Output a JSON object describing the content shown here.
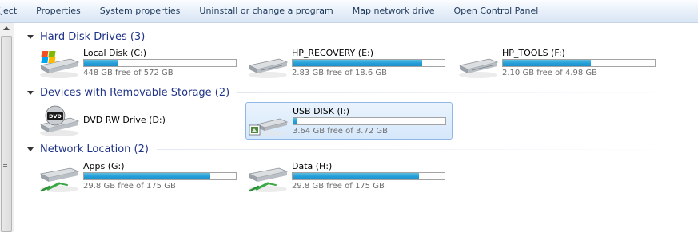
{
  "toolbar": {
    "items": [
      "Eject",
      "Properties",
      "System properties",
      "Uninstall or change a program",
      "Map network drive",
      "Open Control Panel"
    ]
  },
  "groups": [
    {
      "title": "Hard Disk Drives (3)",
      "drives": [
        {
          "name": "Local Disk (C:)",
          "free": "448 GB free of 572 GB",
          "used_fraction": 0.22,
          "icon": "windows-hard-drive-icon"
        },
        {
          "name": "HP_RECOVERY (E:)",
          "free": "2.83 GB free of 18.6 GB",
          "used_fraction": 0.85,
          "icon": "hard-drive-icon"
        },
        {
          "name": "HP_TOOLS (F:)",
          "free": "2.10 GB free of 4.98 GB",
          "used_fraction": 0.58,
          "icon": "hard-drive-icon"
        }
      ]
    },
    {
      "title": "Devices with Removable Storage (2)",
      "drives": [
        {
          "name": "DVD RW Drive (D:)",
          "icon": "dvd-drive-icon",
          "dvd_label": "DVD"
        },
        {
          "name": "USB DISK (I:)",
          "free": "3.64 GB free of 3.72 GB",
          "used_fraction": 0.02,
          "icon": "usb-drive-icon",
          "selected": true
        }
      ]
    },
    {
      "title": "Network Location (2)",
      "drives": [
        {
          "name": "Apps (G:)",
          "free": "29.8 GB free of 175 GB",
          "used_fraction": 0.83,
          "icon": "network-drive-icon"
        },
        {
          "name": "Data (H:)",
          "free": "29.8 GB free of 175 GB",
          "used_fraction": 0.83,
          "icon": "network-drive-icon"
        }
      ]
    }
  ]
}
